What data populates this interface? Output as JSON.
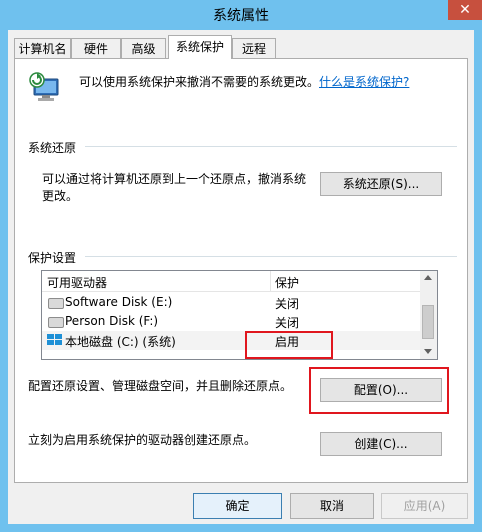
{
  "window": {
    "title": "系统属性",
    "close_label": "✕"
  },
  "tabs": [
    {
      "label": "计算机名"
    },
    {
      "label": "硬件"
    },
    {
      "label": "高级"
    },
    {
      "label": "系统保护"
    },
    {
      "label": "远程"
    }
  ],
  "header": {
    "description": "可以使用系统保护来撤消不需要的系统更改。",
    "link": "什么是系统保护?"
  },
  "restore": {
    "group_title": "系统还原",
    "description_line1": "可以通过将计算机还原到上一个还原点，撤消系统",
    "description_line2": "更改。",
    "button": "系统还原(S)..."
  },
  "protection": {
    "group_title": "保护设置",
    "columns": [
      "可用驱动器",
      "保护"
    ],
    "drives": [
      {
        "name": "Software Disk (E:)",
        "status": "关闭",
        "icon": "drive-icon"
      },
      {
        "name": "Person Disk (F:)",
        "status": "关闭",
        "icon": "drive-icon"
      },
      {
        "name": "本地磁盘 (C:) (系统)",
        "status": "启用",
        "icon": "system-drive-icon"
      }
    ],
    "configure_text": "配置还原设置、管理磁盘空间，并且删除还原点。",
    "configure_button": "配置(O)...",
    "create_text": "立刻为启用系统保护的驱动器创建还原点。",
    "create_button": "创建(C)..."
  },
  "footer": {
    "ok": "确定",
    "cancel": "取消",
    "apply": "应用(A)"
  },
  "colors": {
    "highlight_box": "#e0161e",
    "link": "#0066cc",
    "frame": "#6fc1ee"
  }
}
